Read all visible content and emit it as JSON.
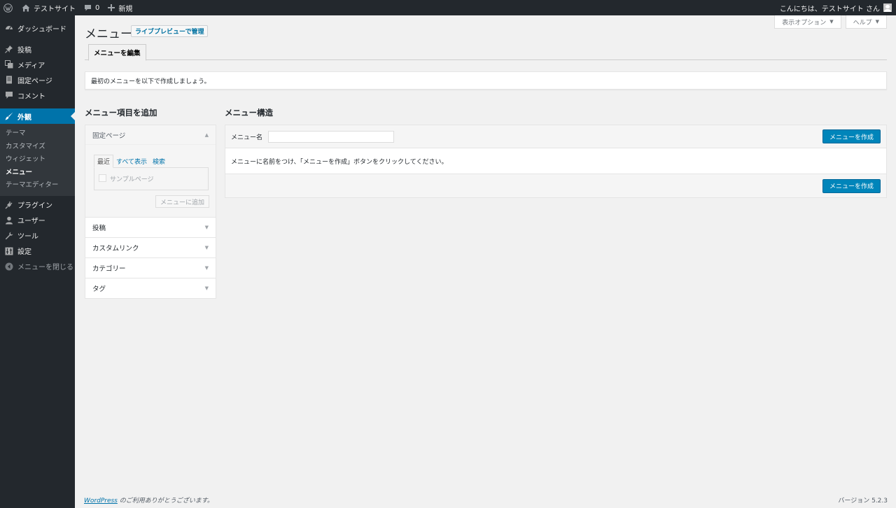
{
  "admin_bar": {
    "site_name": "テストサイト",
    "comments_count": "0",
    "new_label": "新規",
    "greeting": "こんにちは、テストサイト さん"
  },
  "sidebar": {
    "items": [
      {
        "label": "ダッシュボード",
        "icon": "dashboard-icon"
      },
      {
        "label": "投稿",
        "icon": "pushpin-icon"
      },
      {
        "label": "メディア",
        "icon": "media-icon"
      },
      {
        "label": "固定ページ",
        "icon": "page-icon"
      },
      {
        "label": "コメント",
        "icon": "comment-icon"
      },
      {
        "label": "外観",
        "icon": "brush-icon"
      },
      {
        "label": "プラグイン",
        "icon": "plug-icon"
      },
      {
        "label": "ユーザー",
        "icon": "user-icon"
      },
      {
        "label": "ツール",
        "icon": "wrench-icon"
      },
      {
        "label": "設定",
        "icon": "settings-icon"
      },
      {
        "label": "メニューを閉じる",
        "icon": "collapse-icon"
      }
    ],
    "submenu": [
      "テーマ",
      "カスタマイズ",
      "ウィジェット",
      "メニュー",
      "テーマエディター"
    ]
  },
  "screen_meta": {
    "options_label": "表示オプション",
    "help_label": "ヘルプ"
  },
  "page": {
    "title": "メニュー",
    "action_label": "ライブプレビューで管理",
    "tab_label": "メニューを編集",
    "notice": "最初のメニューを以下で作成しましょう。"
  },
  "add_items": {
    "heading": "メニュー項目を追加",
    "open_section": "固定ページ",
    "tabs": [
      "最近",
      "すべて表示",
      "検索"
    ],
    "sample_page": "サンプルページ",
    "add_button": "メニューに追加",
    "sections": [
      "投稿",
      "カスタムリンク",
      "カテゴリー",
      "タグ"
    ]
  },
  "structure": {
    "heading": "メニュー構造",
    "name_label": "メニュー名",
    "name_value": "",
    "create_button": "メニューを作成",
    "instructions": "メニューに名前をつけ、「メニューを作成」ボタンをクリックしてください。"
  },
  "footer": {
    "wp_link": "WordPress",
    "thanks": " のご利用ありがとうございます。",
    "version": "バージョン 5.2.3"
  },
  "colors": {
    "admin_dark": "#23282d",
    "accent_blue": "#0073aa",
    "primary_button": "#0085ba",
    "background": "#f1f1f1"
  }
}
